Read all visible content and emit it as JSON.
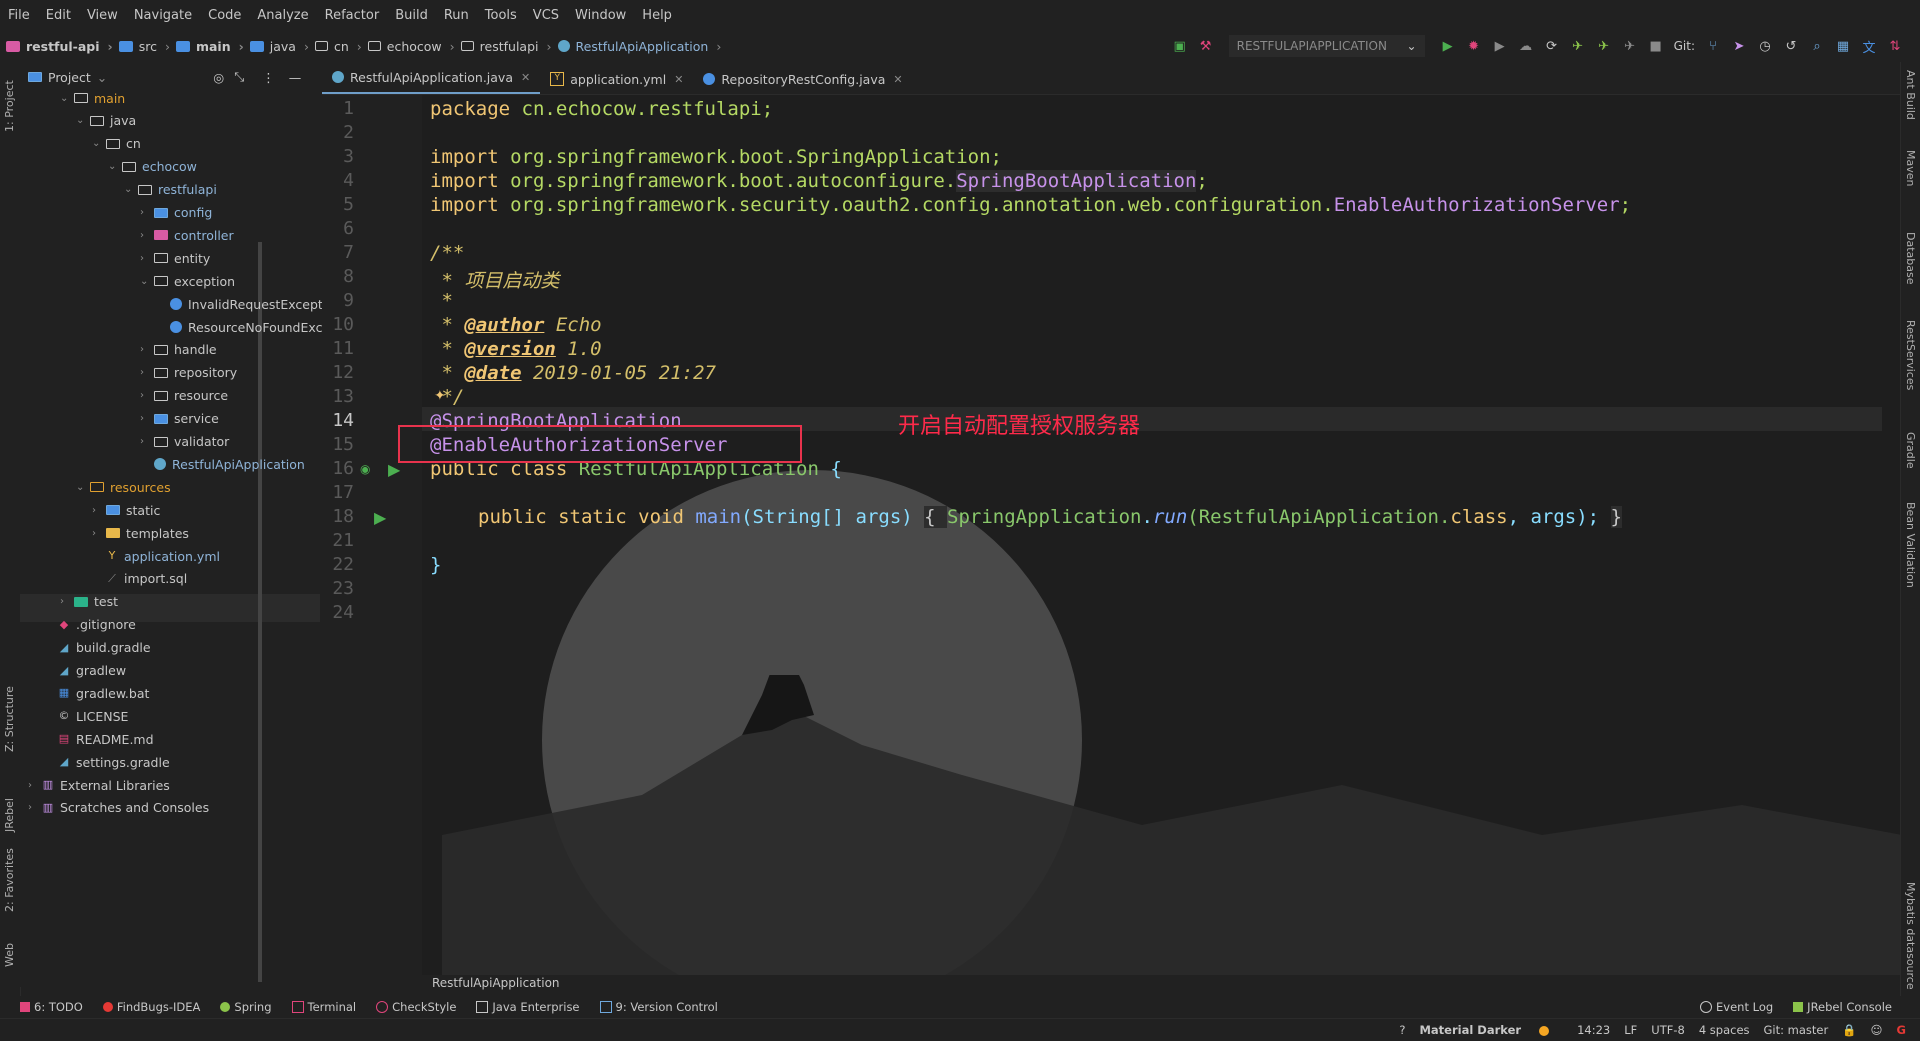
{
  "menu": [
    "File",
    "Edit",
    "View",
    "Navigate",
    "Code",
    "Analyze",
    "Refactor",
    "Build",
    "Run",
    "Tools",
    "VCS",
    "Window",
    "Help"
  ],
  "breadcrumbs": [
    "restful-api",
    "src",
    "main",
    "java",
    "cn",
    "echocow",
    "restfulapi",
    "RestfulApiApplication"
  ],
  "run_config": "RESTFULAPIAPPLICATION",
  "git_label": "Git:",
  "project_panel": {
    "title": "Project",
    "items": [
      {
        "label": "main",
        "depth": 2,
        "type": "folder"
      },
      {
        "label": "java",
        "depth": 3,
        "type": "folder"
      },
      {
        "label": "cn",
        "depth": 4,
        "type": "folder"
      },
      {
        "label": "echocow",
        "depth": 5,
        "type": "folder"
      },
      {
        "label": "restfulapi",
        "depth": 6,
        "type": "folder"
      },
      {
        "label": "config",
        "depth": 7,
        "type": "folder"
      },
      {
        "label": "controller",
        "depth": 7,
        "type": "folder"
      },
      {
        "label": "entity",
        "depth": 7,
        "type": "folder"
      },
      {
        "label": "exception",
        "depth": 7,
        "type": "folder"
      },
      {
        "label": "InvalidRequestException",
        "depth": 8,
        "type": "class"
      },
      {
        "label": "ResourceNoFoundExcep",
        "depth": 8,
        "type": "class"
      },
      {
        "label": "handle",
        "depth": 7,
        "type": "folder"
      },
      {
        "label": "repository",
        "depth": 7,
        "type": "folder"
      },
      {
        "label": "resource",
        "depth": 7,
        "type": "folder"
      },
      {
        "label": "service",
        "depth": 7,
        "type": "folder"
      },
      {
        "label": "validator",
        "depth": 7,
        "type": "folder"
      },
      {
        "label": "RestfulApiApplication",
        "depth": 7,
        "type": "class"
      },
      {
        "label": "resources",
        "depth": 3,
        "type": "folder"
      },
      {
        "label": "static",
        "depth": 4,
        "type": "folder"
      },
      {
        "label": "templates",
        "depth": 4,
        "type": "folder"
      },
      {
        "label": "application.yml",
        "depth": 4,
        "type": "file"
      },
      {
        "label": "import.sql",
        "depth": 4,
        "type": "file"
      },
      {
        "label": "test",
        "depth": 2,
        "type": "folder"
      },
      {
        "label": ".gitignore",
        "depth": 1,
        "type": "file"
      },
      {
        "label": "build.gradle",
        "depth": 1,
        "type": "file"
      },
      {
        "label": "gradlew",
        "depth": 1,
        "type": "file"
      },
      {
        "label": "gradlew.bat",
        "depth": 1,
        "type": "file"
      },
      {
        "label": "LICENSE",
        "depth": 1,
        "type": "file"
      },
      {
        "label": "README.md",
        "depth": 1,
        "type": "file"
      },
      {
        "label": "settings.gradle",
        "depth": 1,
        "type": "file"
      },
      {
        "label": "External Libraries",
        "depth": 0,
        "type": "lib"
      },
      {
        "label": "Scratches and Consoles",
        "depth": 0,
        "type": "lib"
      }
    ]
  },
  "tabs": [
    {
      "label": "RestfulApiApplication.java",
      "active": true
    },
    {
      "label": "application.yml",
      "active": false
    },
    {
      "label": "RepositoryRestConfig.java",
      "active": false
    }
  ],
  "code": {
    "l1_kw": "package",
    "l1_rest": " cn.echocow.restfulapi;",
    "l3_kw": "import",
    "l3_rest": " org.springframework.boot.SpringApplication;",
    "l4_kw": "import",
    "l4_pkg": " org.springframework.boot.autoconfigure.",
    "l4_cls": "SpringBootApplication",
    "l4_end": ";",
    "l5_kw": "import",
    "l5_pkg": " org.springframework.security.oauth2.config.annotation.web.configuration.",
    "l5_cls": "EnableAuthorizationServer",
    "l5_end": ";",
    "l7": "/**",
    "l8": " * 项目启动类",
    "l9": " *",
    "l10_pre": " * ",
    "l10_tag": "@author",
    "l10_val": " Echo",
    "l11_pre": " * ",
    "l11_tag": "@version",
    "l11_val": " 1.0",
    "l12_pre": " * ",
    "l12_tag": "@date",
    "l12_val": " 2019-01-05 21:27",
    "l13": " */",
    "l14": "@SpringBootApplication",
    "l15": "@EnableAuthorizationServer",
    "l16_kw": "public class ",
    "l16_cls": "RestfulApiApplication",
    "l16_end": " {",
    "l18_kw": "public static void ",
    "l18_m": "main",
    "l18_a": "(String[] args) ",
    "l18_b": "{ ",
    "l18_c": "SpringApplication",
    "l18_d": ".",
    "l18_e": "run",
    "l18_f": "(RestfulApiApplication.",
    "l18_g": "class",
    "l18_h": ", args); ",
    "l18_i": "}",
    "l22": "}"
  },
  "line_numbers": [
    "1",
    "2",
    "3",
    "4",
    "5",
    "6",
    "7",
    "8",
    "9",
    "10",
    "11",
    "12",
    "13",
    "14",
    "15",
    "16",
    "17",
    "18",
    "21",
    "22",
    "23",
    "24"
  ],
  "annotation_text": "开启自动配置授权服务器",
  "editor_breadcrumb": "RestfulApiApplication",
  "left_stripe": [
    "1: Project",
    "Z: Structure",
    "JRebel",
    "2: Favorites",
    "Web"
  ],
  "right_stripe": [
    "Ant Build",
    "Maven",
    "Database",
    "RestServices",
    "Gradle",
    "Bean Validation",
    "Mybatis datasource"
  ],
  "tool_windows": [
    "6: TODO",
    "FindBugs-IDEA",
    "Spring",
    "Terminal",
    "CheckStyle",
    "Java Enterprise",
    "9: Version Control"
  ],
  "tool_windows_right": [
    "Event Log",
    "JRebel Console"
  ],
  "status": {
    "theme": "Material Darker",
    "pos": "14:23",
    "lf": "LF",
    "enc": "UTF-8",
    "indent": "4 spaces",
    "git": "Git: master"
  },
  "colors": {
    "accent": "#6f9ec9",
    "annotation": "#e8334d",
    "keyword": "#f0c674",
    "string_pkg": "#b5d964",
    "annot": "#c792ea"
  }
}
